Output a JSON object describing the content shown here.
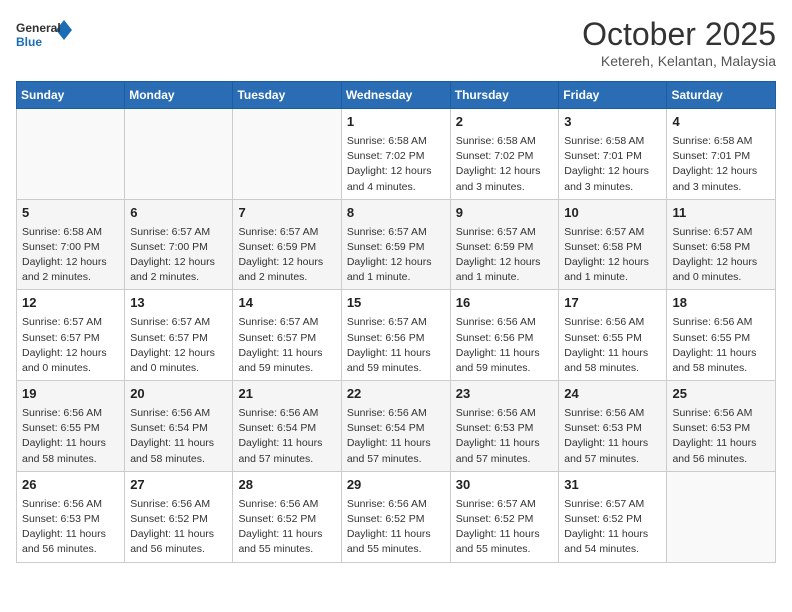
{
  "header": {
    "logo_general": "General",
    "logo_blue": "Blue",
    "month": "October 2025",
    "location": "Ketereh, Kelantan, Malaysia"
  },
  "weekdays": [
    "Sunday",
    "Monday",
    "Tuesday",
    "Wednesday",
    "Thursday",
    "Friday",
    "Saturday"
  ],
  "weeks": [
    [
      {
        "day": "",
        "info": ""
      },
      {
        "day": "",
        "info": ""
      },
      {
        "day": "",
        "info": ""
      },
      {
        "day": "1",
        "info": "Sunrise: 6:58 AM\nSunset: 7:02 PM\nDaylight: 12 hours and 4 minutes."
      },
      {
        "day": "2",
        "info": "Sunrise: 6:58 AM\nSunset: 7:02 PM\nDaylight: 12 hours and 3 minutes."
      },
      {
        "day": "3",
        "info": "Sunrise: 6:58 AM\nSunset: 7:01 PM\nDaylight: 12 hours and 3 minutes."
      },
      {
        "day": "4",
        "info": "Sunrise: 6:58 AM\nSunset: 7:01 PM\nDaylight: 12 hours and 3 minutes."
      }
    ],
    [
      {
        "day": "5",
        "info": "Sunrise: 6:58 AM\nSunset: 7:00 PM\nDaylight: 12 hours and 2 minutes."
      },
      {
        "day": "6",
        "info": "Sunrise: 6:57 AM\nSunset: 7:00 PM\nDaylight: 12 hours and 2 minutes."
      },
      {
        "day": "7",
        "info": "Sunrise: 6:57 AM\nSunset: 6:59 PM\nDaylight: 12 hours and 2 minutes."
      },
      {
        "day": "8",
        "info": "Sunrise: 6:57 AM\nSunset: 6:59 PM\nDaylight: 12 hours and 1 minute."
      },
      {
        "day": "9",
        "info": "Sunrise: 6:57 AM\nSunset: 6:59 PM\nDaylight: 12 hours and 1 minute."
      },
      {
        "day": "10",
        "info": "Sunrise: 6:57 AM\nSunset: 6:58 PM\nDaylight: 12 hours and 1 minute."
      },
      {
        "day": "11",
        "info": "Sunrise: 6:57 AM\nSunset: 6:58 PM\nDaylight: 12 hours and 0 minutes."
      }
    ],
    [
      {
        "day": "12",
        "info": "Sunrise: 6:57 AM\nSunset: 6:57 PM\nDaylight: 12 hours and 0 minutes."
      },
      {
        "day": "13",
        "info": "Sunrise: 6:57 AM\nSunset: 6:57 PM\nDaylight: 12 hours and 0 minutes."
      },
      {
        "day": "14",
        "info": "Sunrise: 6:57 AM\nSunset: 6:57 PM\nDaylight: 11 hours and 59 minutes."
      },
      {
        "day": "15",
        "info": "Sunrise: 6:57 AM\nSunset: 6:56 PM\nDaylight: 11 hours and 59 minutes."
      },
      {
        "day": "16",
        "info": "Sunrise: 6:56 AM\nSunset: 6:56 PM\nDaylight: 11 hours and 59 minutes."
      },
      {
        "day": "17",
        "info": "Sunrise: 6:56 AM\nSunset: 6:55 PM\nDaylight: 11 hours and 58 minutes."
      },
      {
        "day": "18",
        "info": "Sunrise: 6:56 AM\nSunset: 6:55 PM\nDaylight: 11 hours and 58 minutes."
      }
    ],
    [
      {
        "day": "19",
        "info": "Sunrise: 6:56 AM\nSunset: 6:55 PM\nDaylight: 11 hours and 58 minutes."
      },
      {
        "day": "20",
        "info": "Sunrise: 6:56 AM\nSunset: 6:54 PM\nDaylight: 11 hours and 58 minutes."
      },
      {
        "day": "21",
        "info": "Sunrise: 6:56 AM\nSunset: 6:54 PM\nDaylight: 11 hours and 57 minutes."
      },
      {
        "day": "22",
        "info": "Sunrise: 6:56 AM\nSunset: 6:54 PM\nDaylight: 11 hours and 57 minutes."
      },
      {
        "day": "23",
        "info": "Sunrise: 6:56 AM\nSunset: 6:53 PM\nDaylight: 11 hours and 57 minutes."
      },
      {
        "day": "24",
        "info": "Sunrise: 6:56 AM\nSunset: 6:53 PM\nDaylight: 11 hours and 57 minutes."
      },
      {
        "day": "25",
        "info": "Sunrise: 6:56 AM\nSunset: 6:53 PM\nDaylight: 11 hours and 56 minutes."
      }
    ],
    [
      {
        "day": "26",
        "info": "Sunrise: 6:56 AM\nSunset: 6:53 PM\nDaylight: 11 hours and 56 minutes."
      },
      {
        "day": "27",
        "info": "Sunrise: 6:56 AM\nSunset: 6:52 PM\nDaylight: 11 hours and 56 minutes."
      },
      {
        "day": "28",
        "info": "Sunrise: 6:56 AM\nSunset: 6:52 PM\nDaylight: 11 hours and 55 minutes."
      },
      {
        "day": "29",
        "info": "Sunrise: 6:56 AM\nSunset: 6:52 PM\nDaylight: 11 hours and 55 minutes."
      },
      {
        "day": "30",
        "info": "Sunrise: 6:57 AM\nSunset: 6:52 PM\nDaylight: 11 hours and 55 minutes."
      },
      {
        "day": "31",
        "info": "Sunrise: 6:57 AM\nSunset: 6:52 PM\nDaylight: 11 hours and 54 minutes."
      },
      {
        "day": "",
        "info": ""
      }
    ]
  ]
}
